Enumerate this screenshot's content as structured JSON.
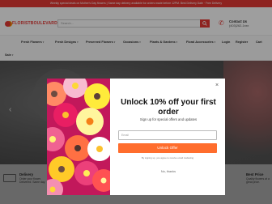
{
  "topbar": {
    "text": "Weekly special deals on Mother's Day flowers | Same day delivery available for orders made before 12PM. Best Delivery Date · Free Delivery"
  },
  "header": {
    "logo_text": "FLORISTBOULEVARD.COM",
    "search_placeholder": "Search...",
    "contact_title": "Contact Us",
    "contact_phone": "(403)262-1xxx",
    "search_icon": "search-icon",
    "phone_icon": "phone-icon"
  },
  "nav": {
    "items": [
      {
        "label": "Fresh Flowers"
      },
      {
        "label": "Fresh Designs"
      },
      {
        "label": "Preserved Flowers"
      },
      {
        "label": "Occasions"
      },
      {
        "label": "Plants & Gardens"
      },
      {
        "label": "Floral Accessories"
      },
      {
        "label": "Login"
      },
      {
        "label": "Register"
      },
      {
        "label": "Cart"
      }
    ]
  },
  "hero": {
    "prev_icon": "chevron-left-icon"
  },
  "features": {
    "left_title": "Delivery",
    "left_sub": "Order your flower. Delivered. Same day.",
    "right_title": "Best Price",
    "right_sub": "Quality flowers at a great price."
  },
  "modal": {
    "title": "Unlock 10% off your first order",
    "subtitle": "Sign up for special offers and updates",
    "email_placeholder": "Email",
    "button_label": "Unlock Offer",
    "terms": "By signing up, you agree to receive email marketing",
    "dismiss": "No, thanks",
    "close_glyph": "×",
    "accent": "#ff6d2d"
  },
  "colors": {
    "brand": "#e53935",
    "cta": "#ff6d2d"
  }
}
